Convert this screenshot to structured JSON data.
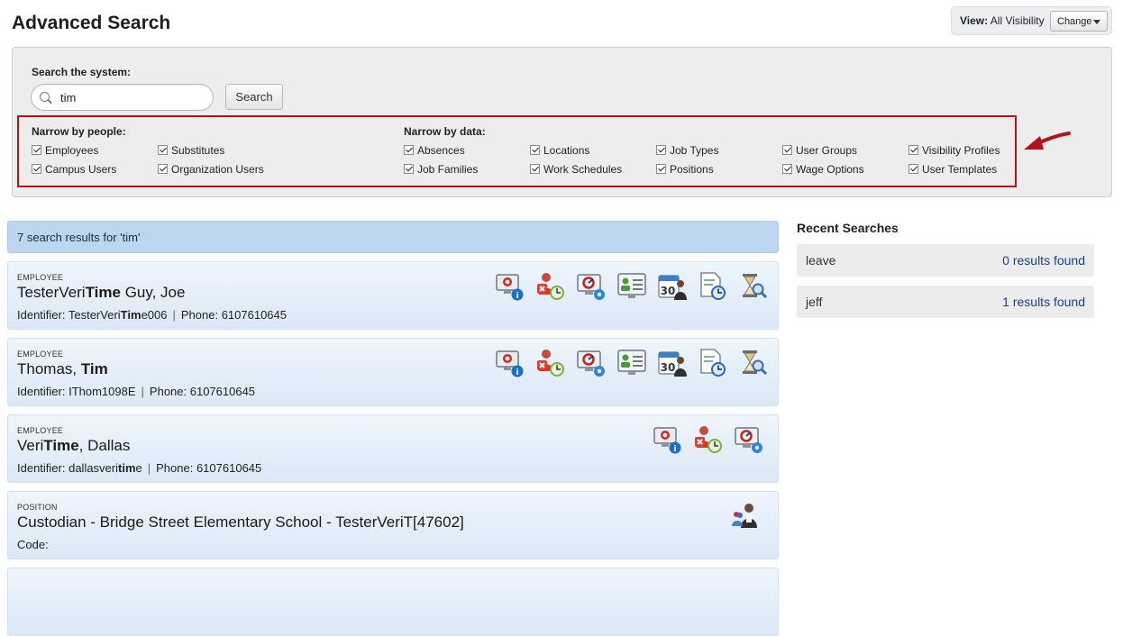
{
  "page": {
    "title": "Advanced Search"
  },
  "view": {
    "label": "View:",
    "value": "All Visibility",
    "change_label": "Change"
  },
  "search": {
    "label": "Search the system:",
    "value": "tim",
    "button_label": "Search"
  },
  "narrow_people": {
    "heading": "Narrow by people:",
    "options": [
      {
        "label": "Employees",
        "checked": true
      },
      {
        "label": "Substitutes",
        "checked": true
      },
      {
        "label": "Campus Users",
        "checked": true
      },
      {
        "label": "Organization Users",
        "checked": true
      }
    ]
  },
  "narrow_data": {
    "heading": "Narrow by data:",
    "options": [
      {
        "label": "Absences",
        "checked": true
      },
      {
        "label": "Locations",
        "checked": true
      },
      {
        "label": "Job Types",
        "checked": true
      },
      {
        "label": "User Groups",
        "checked": true
      },
      {
        "label": "Visibility Profiles",
        "checked": true
      },
      {
        "label": "Job Families",
        "checked": true
      },
      {
        "label": "Work Schedules",
        "checked": true
      },
      {
        "label": "Positions",
        "checked": true
      },
      {
        "label": "Wage Options",
        "checked": true
      },
      {
        "label": "User Templates",
        "checked": true
      }
    ]
  },
  "results": {
    "summary": "7 search results for 'tim'",
    "items": [
      {
        "type": "EMPLOYEE",
        "name_parts": [
          "TesterVeri",
          "Time",
          " Guy, Joe"
        ],
        "identifier_label": "Identifier: ",
        "identifier_parts": [
          "TesterVeri",
          "Tim",
          "e006"
        ],
        "phone": "Phone: 6107610645",
        "icons": [
          "employee-info-icon",
          "absence-delete-icon",
          "settings-screen-icon",
          "profile-card-icon",
          "calendar-30-icon",
          "document-clock-icon",
          "hourglass-search-icon"
        ]
      },
      {
        "type": "EMPLOYEE",
        "name_parts": [
          "Thomas, ",
          "Tim",
          ""
        ],
        "identifier_label": "Identifier: ",
        "identifier_parts": [
          "IThom1098E",
          "",
          ""
        ],
        "phone": "Phone: 6107610645",
        "icons": [
          "employee-info-icon",
          "absence-delete-icon",
          "settings-screen-icon",
          "profile-card-icon",
          "calendar-30-icon",
          "document-clock-icon",
          "hourglass-search-icon"
        ]
      },
      {
        "type": "EMPLOYEE",
        "name_parts": [
          "Veri",
          "Time",
          ", Dallas"
        ],
        "identifier_label": "Identifier: ",
        "identifier_parts": [
          "dallasveri",
          "tim",
          "e"
        ],
        "phone": "Phone: 6107610645",
        "icons": [
          "employee-info-icon",
          "absence-delete-icon",
          "settings-screen-icon"
        ]
      },
      {
        "type": "POSITION",
        "name_parts": [
          "Custodian - Bridge Street Elementary School - TesterVeriT[47602]",
          "",
          ""
        ],
        "code_label": "Code:",
        "icons": [
          "position-people-icon"
        ]
      }
    ]
  },
  "recent": {
    "title": "Recent Searches",
    "items": [
      {
        "query": "leave",
        "result": "0 results found"
      },
      {
        "query": "jeff",
        "result": "1 results found"
      }
    ]
  },
  "colors": {
    "accent_red": "#b5131c",
    "result_header_bg": "#bcd6f1",
    "link_blue": "#1c3f8c"
  }
}
